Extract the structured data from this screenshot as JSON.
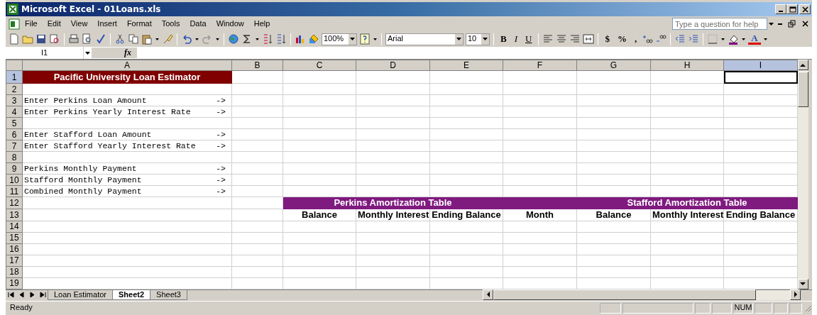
{
  "window": {
    "title": "Microsoft Excel - 01Loans.xls"
  },
  "menu": [
    {
      "label": "File"
    },
    {
      "label": "Edit"
    },
    {
      "label": "View"
    },
    {
      "label": "Insert"
    },
    {
      "label": "Format"
    },
    {
      "label": "Tools"
    },
    {
      "label": "Data"
    },
    {
      "label": "Window"
    },
    {
      "label": "Help"
    }
  ],
  "help_box": {
    "placeholder": "Type a question for help"
  },
  "standard_toolbar": {
    "zoom": "100%"
  },
  "formatting_toolbar": {
    "font": "Arial",
    "size": "10",
    "style_buttons": [
      "B",
      "I",
      "U"
    ],
    "number_buttons": [
      "$",
      "%",
      ","
    ],
    "font_color_label": "A"
  },
  "formula_bar": {
    "name_box": "I1",
    "fx": "fx"
  },
  "sheet": {
    "columns": [
      {
        "label": "A",
        "selected": false
      },
      {
        "label": "B",
        "selected": false
      },
      {
        "label": "C",
        "selected": false
      },
      {
        "label": "D",
        "selected": false
      },
      {
        "label": "E",
        "selected": false
      },
      {
        "label": "F",
        "selected": false
      },
      {
        "label": "G",
        "selected": false
      },
      {
        "label": "H",
        "selected": false
      },
      {
        "label": "I",
        "selected": true
      }
    ],
    "rows": [
      {
        "label": "1",
        "selected": true,
        "cells": [
          {
            "kind": "banner",
            "text": "Pacific University Loan Estimator",
            "color": "#800000"
          }
        ]
      },
      {
        "label": "2",
        "selected": false
      },
      {
        "label": "3",
        "selected": false,
        "cells": [
          {
            "kind": "label",
            "text": "Enter Perkins Loan Amount",
            "arrow": "->"
          }
        ]
      },
      {
        "label": "4",
        "selected": false,
        "cells": [
          {
            "kind": "label",
            "text": "Enter Perkins Yearly Interest Rate",
            "arrow": "->"
          }
        ]
      },
      {
        "label": "5",
        "selected": false
      },
      {
        "label": "6",
        "selected": false,
        "cells": [
          {
            "kind": "label",
            "text": "Enter Stafford Loan Amount",
            "arrow": "->"
          }
        ]
      },
      {
        "label": "7",
        "selected": false,
        "cells": [
          {
            "kind": "label",
            "text": "Enter Stafford Yearly Interest Rate",
            "arrow": "->"
          }
        ]
      },
      {
        "label": "8",
        "selected": false
      },
      {
        "label": "9",
        "selected": false,
        "cells": [
          {
            "kind": "label",
            "text": "Perkins Monthly Payment",
            "arrow": "->"
          }
        ]
      },
      {
        "label": "10",
        "selected": false,
        "cells": [
          {
            "kind": "label",
            "text": "Stafford Monthly Payment",
            "arrow": "->"
          }
        ]
      },
      {
        "label": "11",
        "selected": false,
        "cells": [
          {
            "kind": "label",
            "text": "Combined Monthly Payment",
            "arrow": "->"
          }
        ]
      },
      {
        "label": "12",
        "selected": false,
        "cells": [
          {
            "kind": "empty"
          },
          {
            "kind": "empty"
          },
          {
            "kind": "banner",
            "text": "Perkins Amortization Table",
            "color": "#7f1a7f"
          },
          {
            "kind": "merged"
          },
          {
            "kind": "merged"
          },
          {
            "kind": "fill",
            "color": "#7f1a7f"
          },
          {
            "kind": "banner",
            "text": "Stafford Amortization Table",
            "color": "#7f1a7f"
          },
          {
            "kind": "merged"
          },
          {
            "kind": "merged"
          }
        ]
      },
      {
        "label": "13",
        "selected": false,
        "cells": [
          {
            "kind": "empty"
          },
          {
            "kind": "empty"
          },
          {
            "kind": "header",
            "text": "Balance"
          },
          {
            "kind": "header",
            "text": "Monthly Interest"
          },
          {
            "kind": "header",
            "text": "Ending Balance"
          },
          {
            "kind": "header",
            "text": "Month"
          },
          {
            "kind": "header",
            "text": "Balance"
          },
          {
            "kind": "header",
            "text": "Monthly Interest"
          },
          {
            "kind": "header",
            "text": "Ending Balance"
          }
        ]
      },
      {
        "label": "14",
        "selected": false
      },
      {
        "label": "15",
        "selected": false
      },
      {
        "label": "16",
        "selected": false
      },
      {
        "label": "17",
        "selected": false
      },
      {
        "label": "18",
        "selected": false
      },
      {
        "label": "19",
        "selected": false
      }
    ]
  },
  "sheet_tabs": [
    {
      "label": "Loan Estimator",
      "selected": false
    },
    {
      "label": "Sheet2",
      "selected": true
    },
    {
      "label": "Sheet3",
      "selected": false
    }
  ],
  "status_bar": {
    "text": "Ready",
    "num": "NUM"
  }
}
